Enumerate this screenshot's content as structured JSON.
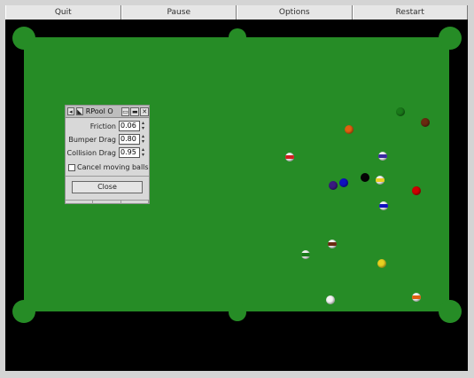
{
  "menu": {
    "items": [
      "Quit",
      "Pause",
      "Options",
      "Restart"
    ]
  },
  "dialog": {
    "title": "RPool O",
    "icons": [
      "window-menu-icon",
      "shade-icon",
      "minimize-icon",
      "maximize-icon",
      "close-icon"
    ],
    "rows": [
      {
        "label": "Friction",
        "value": "0.06"
      },
      {
        "label": "Bumper Drag",
        "value": "0.80"
      },
      {
        "label": "Collision Drag",
        "value": "0.95"
      }
    ],
    "checkbox_label": "Cancel moving balls",
    "close_label": "Close"
  },
  "colors": {
    "felt": "#268c26",
    "rail": "#000000"
  },
  "balls": [
    {
      "name": "green",
      "color": "#1a7a1a",
      "stripe": false
    },
    {
      "name": "maroon",
      "color": "#6a2a10",
      "stripe": false
    },
    {
      "name": "orange",
      "color": "#e06010",
      "stripe": false
    },
    {
      "name": "red-stripe",
      "color": "#d02020",
      "stripe": true
    },
    {
      "name": "purple-stripe",
      "color": "#3a2aa0",
      "stripe": true
    },
    {
      "name": "black",
      "color": "#050505",
      "stripe": false
    },
    {
      "name": "blue",
      "color": "#1010c0",
      "stripe": false
    },
    {
      "name": "purple",
      "color": "#3a1a80",
      "stripe": false
    },
    {
      "name": "yellow-stripe",
      "color": "#e8d020",
      "stripe": true
    },
    {
      "name": "red",
      "color": "#d00000",
      "stripe": false
    },
    {
      "name": "blue-stripe",
      "color": "#1010c0",
      "stripe": true
    },
    {
      "name": "maroon-stripe",
      "color": "#6a2a10",
      "stripe": true
    },
    {
      "name": "green-stripe",
      "color": "#1a7a1a",
      "stripe": true
    },
    {
      "name": "yellow",
      "color": "#e8d020",
      "stripe": false
    },
    {
      "name": "cue",
      "color": "#f4f4f4",
      "stripe": false
    },
    {
      "name": "orange-stripe",
      "color": "#e06010",
      "stripe": true
    }
  ]
}
